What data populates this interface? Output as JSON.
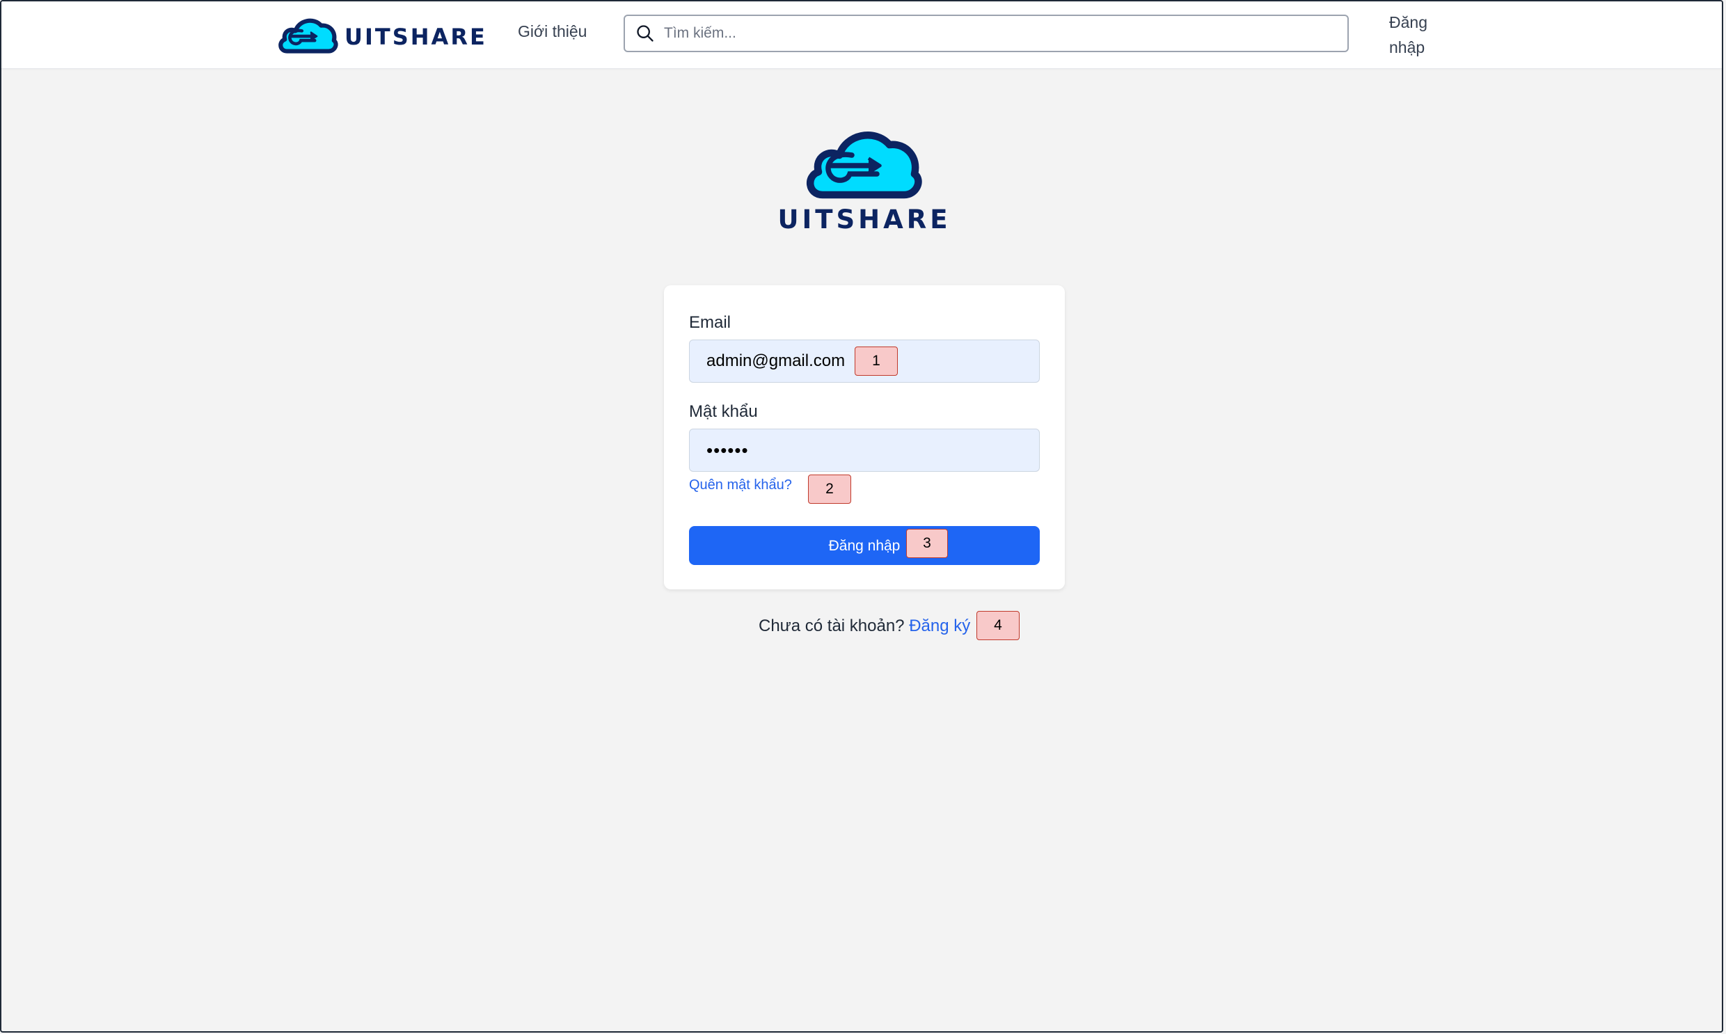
{
  "brand": {
    "name": "UITSHARE",
    "colors": {
      "navy": "#0c2461",
      "cyan": "#00dcff",
      "primary": "#1e66f5",
      "link": "#2563eb"
    }
  },
  "header": {
    "about_label": "Giới thiệu",
    "search_placeholder": "Tìm kiếm...",
    "search_icon": "search-icon",
    "login_line1": "Đăng",
    "login_line2": "nhập"
  },
  "login_form": {
    "email_label": "Email",
    "email_value": "admin@gmail.com",
    "password_label": "Mật khẩu",
    "password_value": "••••••",
    "forgot_link": "Quên mật khẩu?",
    "submit_label": "Đăng nhập"
  },
  "signup": {
    "prompt": "Chưa có tài khoản?",
    "link": "Đăng ký"
  },
  "badges": [
    "1",
    "2",
    "3",
    "4"
  ]
}
